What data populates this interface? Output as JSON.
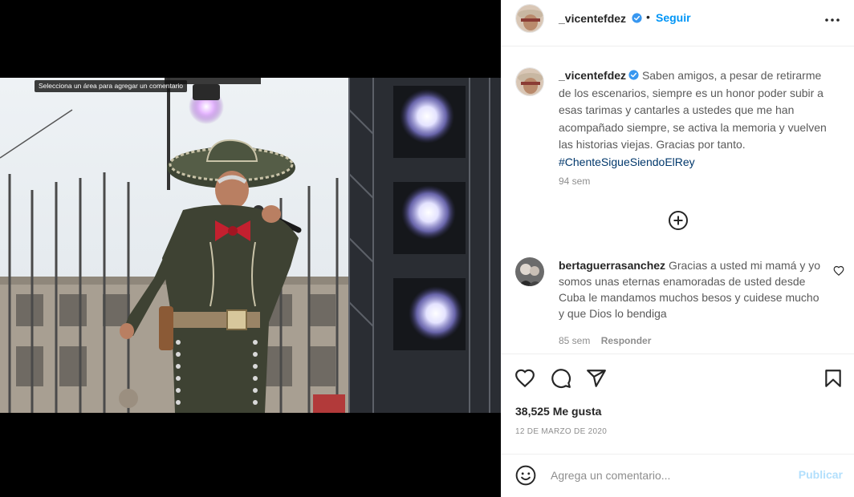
{
  "media": {
    "tooltip": "Selecciona un área para agregar un comentario"
  },
  "header": {
    "username": "_vicentefdez",
    "verified": true,
    "separator": "•",
    "follow_label": "Seguir",
    "more_icon": "more-horizontal-icon"
  },
  "caption": {
    "username": "_vicentefdez",
    "text": "Saben amigos, a pesar de retirarme de los escenarios, siempre es un honor poder subir a esas tarimas y cantarles a ustedes que me han acompañado siempre, se activa la memoria y vuelven las historias viejas. Gracias por tanto.",
    "hashtag": "#ChenteSigueSiendoElRey",
    "time": "94 sem"
  },
  "comments": [
    {
      "username": "bertaguerrasanchez",
      "text": "Gracias a usted mi mamá y yo somos unas eternas enamoradas de usted desde Cuba le mandamos muchos besos y cuidese mucho y que Dios lo bendiga",
      "time": "85 sem",
      "reply_label": "Responder"
    }
  ],
  "actions": {
    "icons": [
      "heart-icon",
      "comment-icon",
      "share-icon",
      "bookmark-icon"
    ],
    "likes_count": "38,525",
    "likes_label": "Me gusta",
    "date": "12 de marzo de 2020"
  },
  "comment_box": {
    "placeholder": "Agrega un comentario...",
    "publish_label": "Publicar"
  },
  "colors": {
    "link_blue": "#0095f6",
    "hashtag_blue": "#00376b",
    "publish_disabled": "#b2dffc",
    "text_secondary": "#8e8e8e",
    "verified_blue": "#3897f0"
  }
}
